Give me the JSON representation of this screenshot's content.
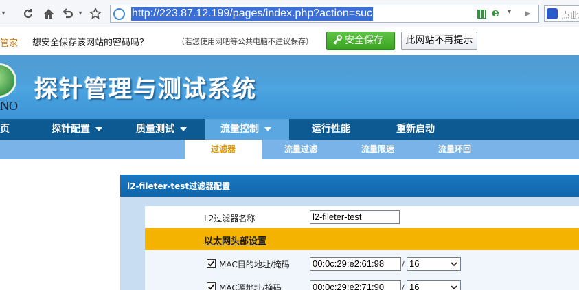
{
  "browser": {
    "url": "http://223.87.12.199/pages/index.php?action=suc",
    "search_placeholder": "点此",
    "search_logo": "🐾"
  },
  "password_bar": {
    "brand": "管家",
    "question": "想安全保存该网站的密码吗？",
    "note": "（若您使用网吧等公共电脑不建议保存）",
    "save_label": "安全保存",
    "never_label": "此网站不再提示"
  },
  "banner": {
    "title": "探针管理与测试系统",
    "logo_text": "NO"
  },
  "main_nav": [
    {
      "label": "页"
    },
    {
      "label": "探针配置",
      "caret": true
    },
    {
      "label": "质量测试",
      "caret": true
    },
    {
      "label": "流量控制",
      "caret": true,
      "active": true
    },
    {
      "label": "运行性能"
    },
    {
      "label": "重新启动"
    }
  ],
  "sub_nav": [
    {
      "label": "过滤器",
      "active": true
    },
    {
      "label": "流量过滤"
    },
    {
      "label": "流量限速"
    },
    {
      "label": "流量环回"
    }
  ],
  "panel": {
    "title": "l2-fileter-test过滤器配置",
    "filter_name_label": "L2过滤器名称",
    "filter_name_value": "l2-fileter-test",
    "section_label": "以太网头部设置",
    "rows": [
      {
        "label": "MAC目的地址/掩码",
        "checked": true,
        "value": "00:0c:29:e2:61:98",
        "mask": "16"
      },
      {
        "label": "MAC源地址/掩码",
        "checked": true,
        "value": "00:0c:29:e2:71:90",
        "mask": "16"
      }
    ],
    "slash": "/"
  },
  "colors": {
    "nav_bg": "#0d5a92",
    "nav_active": "#5aa7e2",
    "subnav_bg": "#79b3e7",
    "sub_active_text": "#e09700",
    "section_bg": "#f3b300",
    "panel_head": "#1a78c2",
    "save_green": "#3aa322"
  }
}
